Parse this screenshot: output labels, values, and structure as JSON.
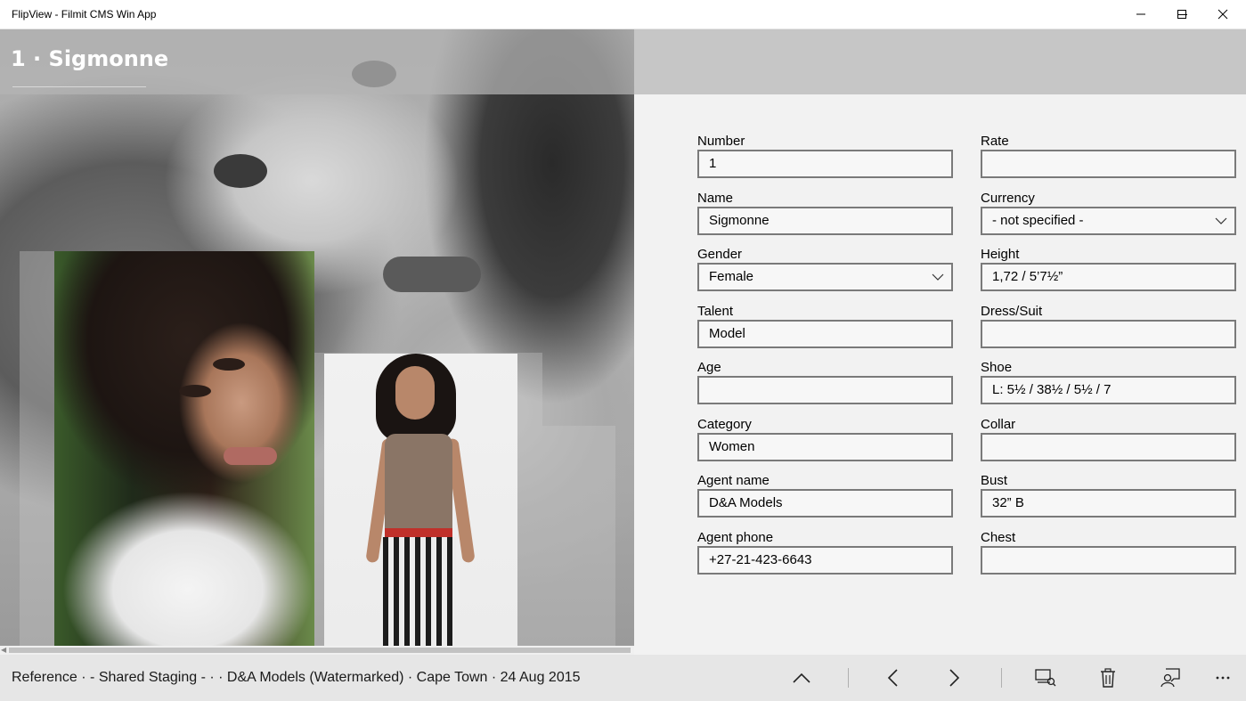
{
  "window": {
    "title": "FlipView - Filmit CMS Win App",
    "minimize_icon": "minimize-icon",
    "maximize_icon": "maximize-icon",
    "close_icon": "close-icon"
  },
  "header": {
    "title": "1 · Sigmonne"
  },
  "form": {
    "left": [
      {
        "label": "Number",
        "value": "1",
        "type": "text"
      },
      {
        "label": "Name",
        "value": "Sigmonne",
        "type": "text"
      },
      {
        "label": "Gender",
        "value": "Female",
        "type": "select"
      },
      {
        "label": "Talent",
        "value": "Model",
        "type": "text"
      },
      {
        "label": "Age",
        "value": "",
        "type": "text"
      },
      {
        "label": "Category",
        "value": "Women",
        "type": "text"
      },
      {
        "label": "Agent name",
        "value": "D&A Models",
        "type": "text"
      },
      {
        "label": "Agent phone",
        "value": "+27-21-423-6643",
        "type": "text"
      }
    ],
    "right": [
      {
        "label": "Rate",
        "value": "",
        "type": "text"
      },
      {
        "label": "Currency",
        "value": "- not specified -",
        "type": "select"
      },
      {
        "label": "Height",
        "value": "1,72 / 5’7½”",
        "type": "text"
      },
      {
        "label": "Dress/Suit",
        "value": "",
        "type": "text"
      },
      {
        "label": "Shoe",
        "value": "L: 5½ / 38½ / 5½ / 7",
        "type": "text"
      },
      {
        "label": "Collar",
        "value": "",
        "type": "text"
      },
      {
        "label": "Bust",
        "value": "32” B",
        "type": "text"
      },
      {
        "label": "Chest",
        "value": "",
        "type": "text"
      }
    ]
  },
  "statusbar": {
    "text": "Reference · - Shared Staging - ·  · D&A Models (Watermarked) · Cape Town · 24 Aug 2015"
  },
  "appbar": {
    "buttons": [
      "chevron-up-icon",
      "previous-icon",
      "next-icon",
      "gallery-icon",
      "delete-icon",
      "contact-card-icon",
      "more-icon"
    ]
  },
  "colors": {
    "accent_border": "#7a7a7a",
    "background": "#f2f2f2",
    "appbar": "#e6e6e6"
  }
}
